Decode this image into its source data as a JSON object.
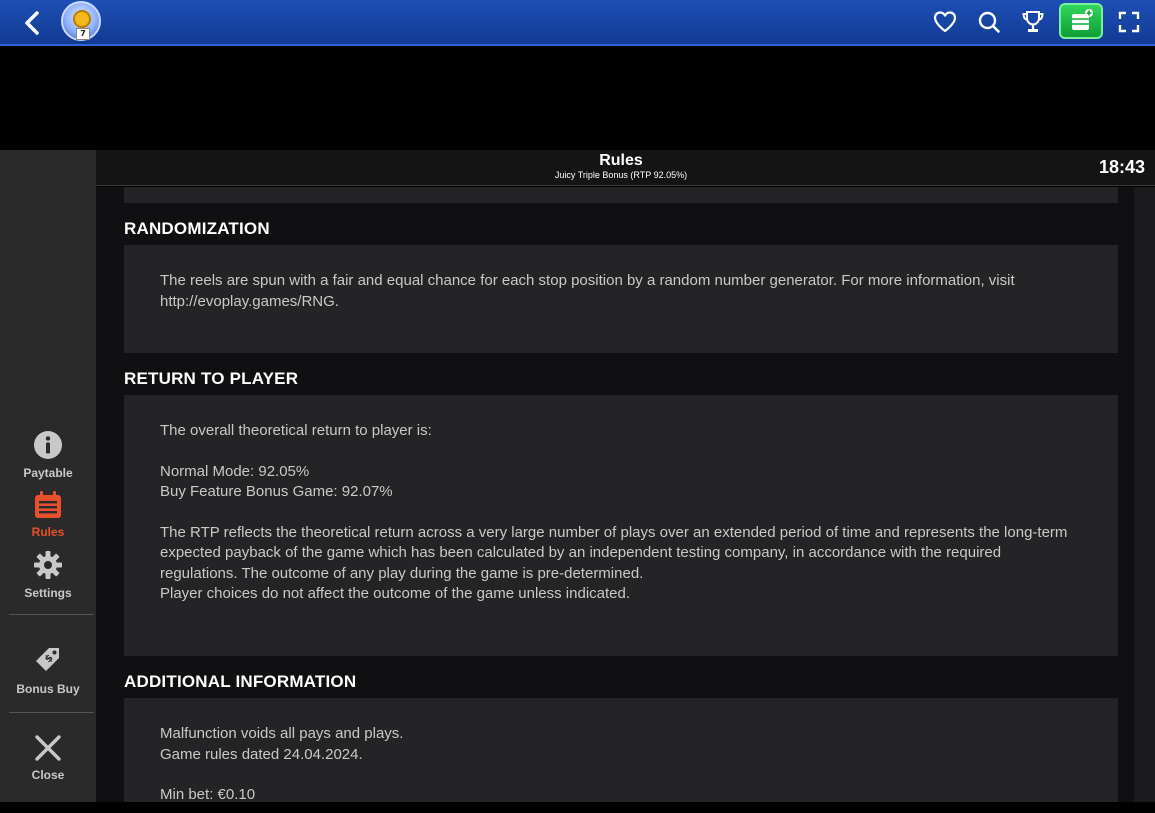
{
  "topbar": {
    "avatar_level": "7",
    "colors": {
      "bar": "#1a47a8",
      "cash": "#20c048"
    },
    "icons": [
      "back-icon",
      "heart-icon",
      "search-icon",
      "trophy-icon",
      "cash-icon",
      "fullscreen-icon"
    ]
  },
  "header": {
    "title": "Rules",
    "subtitle": "Juicy Triple Bonus (RTP 92.05%)",
    "clock": "18:43"
  },
  "sidebar": {
    "items": [
      {
        "label": "Paytable",
        "icon": "info-icon"
      },
      {
        "label": "Rules",
        "icon": "calendar-icon",
        "active": true,
        "active_color": "#e8502b"
      },
      {
        "label": "Settings",
        "icon": "gear-icon"
      },
      {
        "label": "Bonus Buy",
        "icon": "price-tag-icon"
      },
      {
        "label": "Close",
        "icon": "close-icon"
      }
    ]
  },
  "sections": {
    "randomization": {
      "title": "RANDOMIZATION",
      "text": "The reels are spun with a fair and equal chance for each stop position by a random number generator. For more information, visit http://evoplay.games/RNG."
    },
    "rtp": {
      "title": "RETURN TO PLAYER",
      "intro": "The overall theoretical return to player is:",
      "normal": "Normal Mode: 92.05%",
      "buy": "Buy Feature Bonus Game: 92.07%",
      "para": "The RTP reflects the theoretical return across a very large number of plays over an extended period of time and represents the long-term expected payback of the game which has been calculated by an independent testing company, in accordance with the required regulations. The outcome of any play during the game is pre-determined.",
      "choices": "Player choices do not affect the outcome of the game unless indicated."
    },
    "additional": {
      "title": "ADDITIONAL INFORMATION",
      "malfunction": "Malfunction voids all pays and plays.",
      "dated": "Game rules dated 24.04.2024.",
      "minbet": "Min bet: €0.10"
    }
  }
}
